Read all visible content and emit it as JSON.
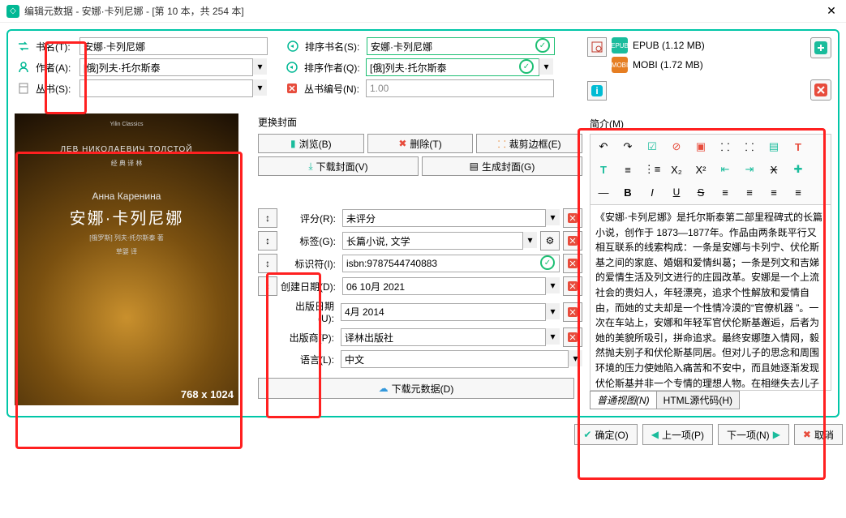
{
  "window": {
    "title": "编辑元数据 - 安娜·卡列尼娜 -  [第 10 本，共 254 本]"
  },
  "labels": {
    "title": "书名(T):",
    "sort_title": "排序书名(S):",
    "author": "作者(A):",
    "sort_author": "排序作者(Q):",
    "series": "丛书(S):",
    "series_index": "丛书编号(N):",
    "change_cover": "更换封面",
    "browse": "浏览(B)",
    "delete": "删除(T)",
    "trim": "裁剪边框(E)",
    "download_cover": "下载封面(V)",
    "generate_cover": "生成封面(G)",
    "rating": "评分(R):",
    "tags": "标签(G):",
    "ids": "标识符(I):",
    "date": "创建日期(D):",
    "pubdate": "出版日期 (U):",
    "publisher": "出版商(P):",
    "language": "语言(L):",
    "download_meta": "下载元数据(D)",
    "comments": "简介(M)",
    "tab_normal": "普通视图(N)",
    "tab_html": "HTML源代码(H)",
    "ok": "确定(O)",
    "prev": "上一项(P)",
    "next": "下一项(N)",
    "cancel": "取消"
  },
  "fields": {
    "title": "安娜·卡列尼娜",
    "sort_title": "安娜·卡列尼娜",
    "author": "[俄]列夫·托尔斯泰",
    "sort_author": "[俄]列夫·托尔斯泰",
    "series": "",
    "series_index": "1.00",
    "rating": "未评分",
    "tags": "长篇小说, 文学",
    "ids": "isbn:9787544740883",
    "date": "06 10月 2021",
    "pubdate": "4月 2014",
    "publisher": "译林出版社",
    "language": "中文"
  },
  "cover": {
    "series_label": "Yilin Classics",
    "rus_author": "ЛЕВ НИКОЛАЕВИЧ ТОЛСТОЙ",
    "rus_tag": "经 典 译 林",
    "rus_title": "Анна Каренина",
    "cn_title": "安娜·卡列尼娜",
    "author_line": "[俄罗斯] 列夫·托尔斯泰 著",
    "translator": "草婴 译",
    "dimensions": "768 x 1024"
  },
  "formats": [
    {
      "name": "EPUB",
      "size": "1.12 MB",
      "color": "#1abc9c"
    },
    {
      "name": "MOBI",
      "size": "1.72 MB",
      "color": "#e67e22"
    }
  ],
  "comments_text": "《安娜·卡列尼娜》是托尔斯泰第二部里程碑式的长篇小说，创作于 1873—1877年。作品由两条既平行又相互联系的线索构成：一条是安娜与卡列宁、伏伦斯基之间的家庭、婚姻和爱情纠葛；一条是列文和吉娣的爱情生活及列文进行的庄园改革。安娜是一个上流社会的贵妇人，年轻漂亮，追求个性解放和爱情自由，而她的丈夫却是一个性情冷漠的“官僚机器 ”。一次在车站上，安娜和年轻军官伏伦斯基邂逅，后者为她的美貌所吸引，拼命追求。最终安娜堕入情网，毅然抛夫别子和伏伦斯基同居。但对儿子的思念和周围环境的压力使她陷入痛苦和不安中，而且她逐渐发现伏伦斯基并非一个专情的理想人物。在相继失去儿子和精神上最后一根支柱 ——伏伦斯基"
}
